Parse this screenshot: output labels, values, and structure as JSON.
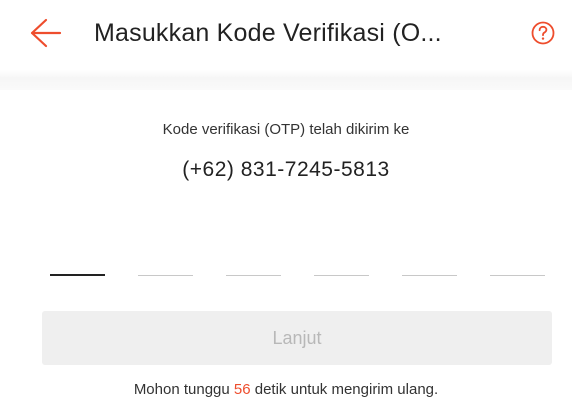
{
  "header": {
    "title": "Masukkan Kode Verifikasi (O...",
    "back_icon": "arrow-left-icon",
    "help_icon": "question-circle-icon"
  },
  "info": {
    "sent_text": "Kode verifikasi (OTP) telah dikirim ke",
    "phone": "(+62) 831-7245-5813"
  },
  "otp": {
    "length": 6,
    "values": [
      "",
      "",
      "",
      "",
      "",
      ""
    ],
    "active_index": 0
  },
  "actions": {
    "next_label": "Lanjut"
  },
  "resend": {
    "prefix": "Mohon tunggu ",
    "countdown": "56",
    "suffix": " detik untuk mengirim ulang."
  },
  "colors": {
    "accent": "#ee4d2d",
    "disabled_button_bg": "#efefef",
    "disabled_button_text": "#b8b8b8"
  }
}
